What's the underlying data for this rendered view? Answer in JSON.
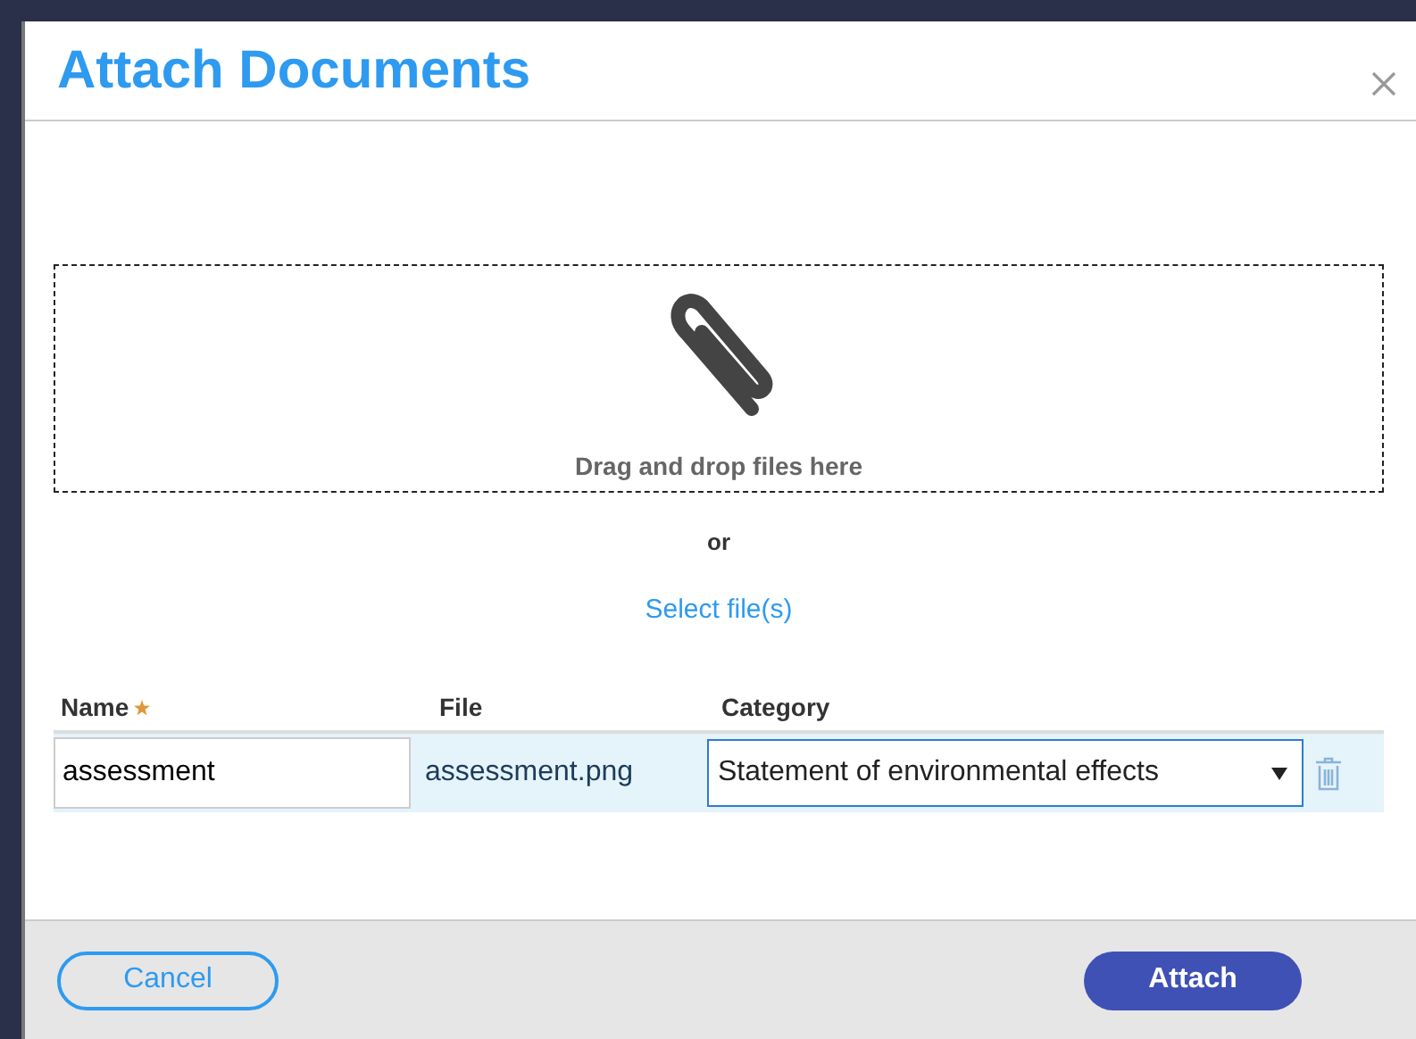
{
  "dialog": {
    "title": "Attach Documents"
  },
  "dropzone": {
    "hint": "Drag and drop files here"
  },
  "separator": "or",
  "select_link": "Select file(s)",
  "table": {
    "columns": [
      {
        "label": "Name",
        "required": true
      },
      {
        "label": "File",
        "required": false
      },
      {
        "label": "Category",
        "required": false
      }
    ],
    "rows": [
      {
        "name": "assessment",
        "file": "assessment.png",
        "category": "Statement of environmental effects"
      }
    ]
  },
  "buttons": [
    {
      "label": "Cancel",
      "kind": "secondary"
    },
    {
      "label": "Attach",
      "kind": "primary"
    }
  ]
}
